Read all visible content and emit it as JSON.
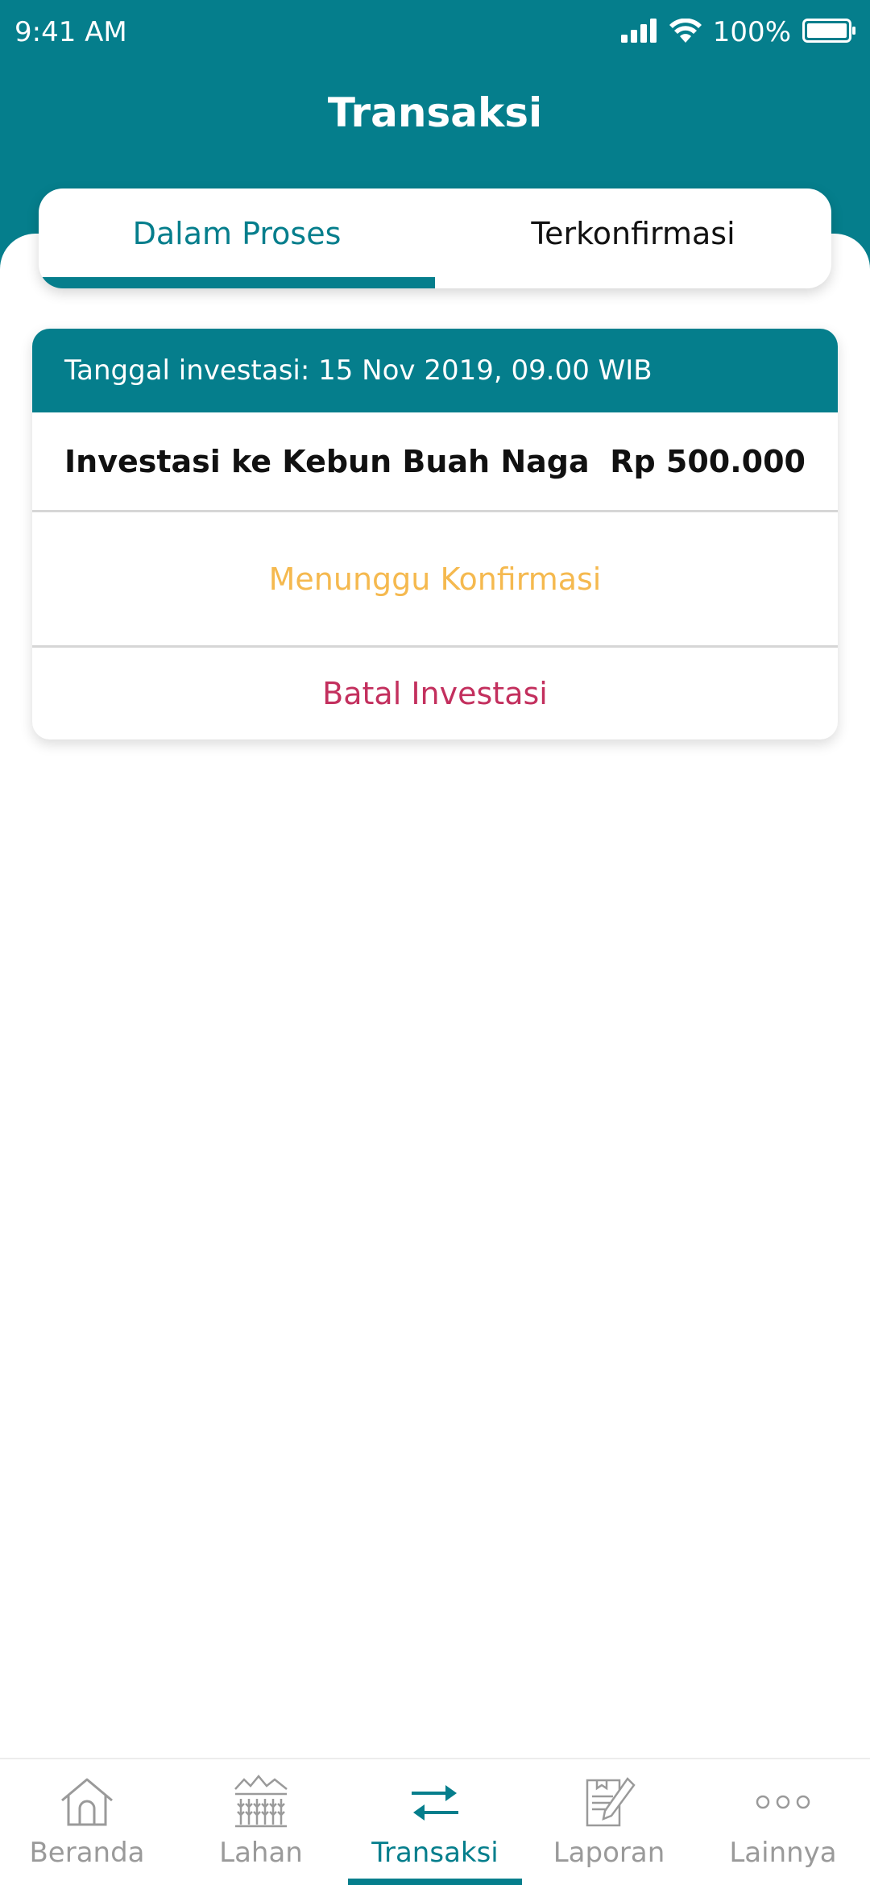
{
  "status_bar": {
    "time": "9:41 AM",
    "battery": "100%"
  },
  "header": {
    "title": "Transaksi"
  },
  "tabs": [
    {
      "label": "Dalam Proses",
      "active": true
    },
    {
      "label": "Terkonfirmasi",
      "active": false
    }
  ],
  "transaction": {
    "date_line": "Tanggal investasi: 15 Nov 2019, 09.00 WIB",
    "title": "Investasi ke Kebun Buah Naga",
    "amount": "Rp 500.000",
    "status": "Menunggu Konfirmasi",
    "cancel_label": "Batal Investasi"
  },
  "bottom_nav": [
    {
      "label": "Beranda",
      "icon": "home-icon",
      "active": false
    },
    {
      "label": "Lahan",
      "icon": "farm-field-icon",
      "active": false
    },
    {
      "label": "Transaksi",
      "icon": "transfer-arrows-icon",
      "active": true
    },
    {
      "label": "Laporan",
      "icon": "report-pencil-icon",
      "active": false
    },
    {
      "label": "Lainnya",
      "icon": "more-dots-icon",
      "active": false
    }
  ],
  "colors": {
    "primary": "#057e8c",
    "pending": "#f5b94f",
    "cancel": "#c3305e",
    "inactive": "#9a9a9a"
  }
}
